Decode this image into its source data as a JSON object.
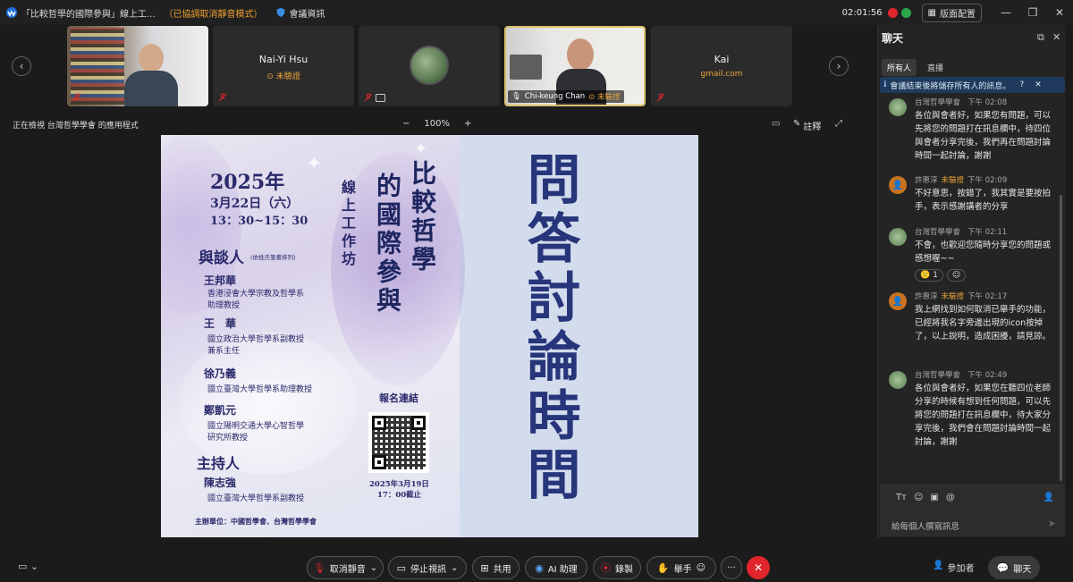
{
  "window": {
    "title": "「比較哲學的國際參與」線上工...",
    "status": "（已協調取消靜音模式）",
    "meeting_info": "會議資訊",
    "timer": "02:01:56",
    "layout_label": "版面配置"
  },
  "participants": [
    {
      "name": "",
      "subtitle": ""
    },
    {
      "name": "Nai-Yi Hsu",
      "subtitle": "未驗證"
    },
    {
      "name": "",
      "subtitle": ""
    },
    {
      "name": "Chi-keung Chan",
      "subtitle": "未驗證"
    },
    {
      "name": "Kai",
      "subtitle": "gmail.com"
    }
  ],
  "view": {
    "viewing": "正在檢視 台灣哲學學會 的應用程式",
    "zoom": "100%",
    "minus": "−",
    "plus": "+",
    "annotate": "註釋"
  },
  "poster": {
    "year": "2025年",
    "date": "3月22日（六）",
    "time": "13：30~15：30",
    "workshop": "線上工作坊",
    "title_col1": "比較哲學",
    "title_col2": "的國際參與",
    "panel_label": "與談人",
    "panel_note": "(依姓氏筆畫排列)",
    "speakers": [
      {
        "name": "王邦華",
        "title1": "香港浸會大學宗教及哲學系",
        "title2": "助理教授"
      },
      {
        "name": "王　華",
        "title1": "國立政治大學哲學系副教授",
        "title2": "兼系主任"
      },
      {
        "name": "徐乃義",
        "title1": "國立臺灣大學哲學系助理教授",
        "title2": ""
      },
      {
        "name": "鄭凱元",
        "title1": "國立陽明交通大學心智哲學",
        "title2": "研究所教授"
      }
    ],
    "host_label": "主持人",
    "host_name": "陳志強",
    "host_title": "國立臺灣大學哲學系副教授",
    "organizer": "主辦單位：中國哲學會、台灣哲學學會",
    "register": "報名連結",
    "deadline1": "2025年3月19日",
    "deadline2": "17：00截止",
    "big_text": "問答討論時間"
  },
  "chat": {
    "title": "聊天",
    "tab_all": "所有人",
    "tab_live": "直播",
    "notice": "會議結束後將儲存所有人的訊息。",
    "messages": [
      {
        "sender": "台灣哲學學會",
        "unverified": "",
        "time": "下午 02:08",
        "text": "各位與會者好，如果您有問題，可以先將您的問題打在訊息欄中，待四位與會者分享完後，我們再在問題討論時間一起討論，謝謝"
      },
      {
        "sender": "許惠淳",
        "unverified": "未驗證",
        "time": "下午 02:09",
        "text": "不好意思，按錯了，我其實是要按拍手，表示感謝講者的分享"
      },
      {
        "sender": "台灣哲學學會",
        "unverified": "",
        "time": "下午 02:11",
        "text": "不會，也歡迎您隨時分享您的問題或感想喔~~"
      },
      {
        "sender": "許惠淳",
        "unverified": "未驗證",
        "time": "下午 02:17",
        "text": "我上網找到如何取消已舉手的功能，已經將我名字旁邊出現的icon按掉了，以上說明，造成困擾，請見諒。"
      },
      {
        "sender": "台灣哲學學會",
        "unverified": "",
        "time": "下午 02:49",
        "text": "各位與會者好，如果您在聽四位老師分享的時候有想到任何問題，可以先將您的問題打在訊息欄中，待大家分享完後，我們會在問題討論時間一起討論，謝謝"
      }
    ],
    "reaction_count": "1",
    "placeholder": "給每個人撰寫訊息"
  },
  "toolbar": {
    "unmute": "取消靜音",
    "stop_video": "停止視訊",
    "share": "共用",
    "ai": "AI 助理",
    "record": "錄製",
    "raise_hand": "舉手",
    "more": "···",
    "participants": "參加者",
    "chat": "聊天"
  },
  "colors": {
    "accent_blue": "#1f6fd8",
    "warning_orange": "#e8a33a",
    "end_red": "#e0262c",
    "poster_navy": "#27357a"
  }
}
